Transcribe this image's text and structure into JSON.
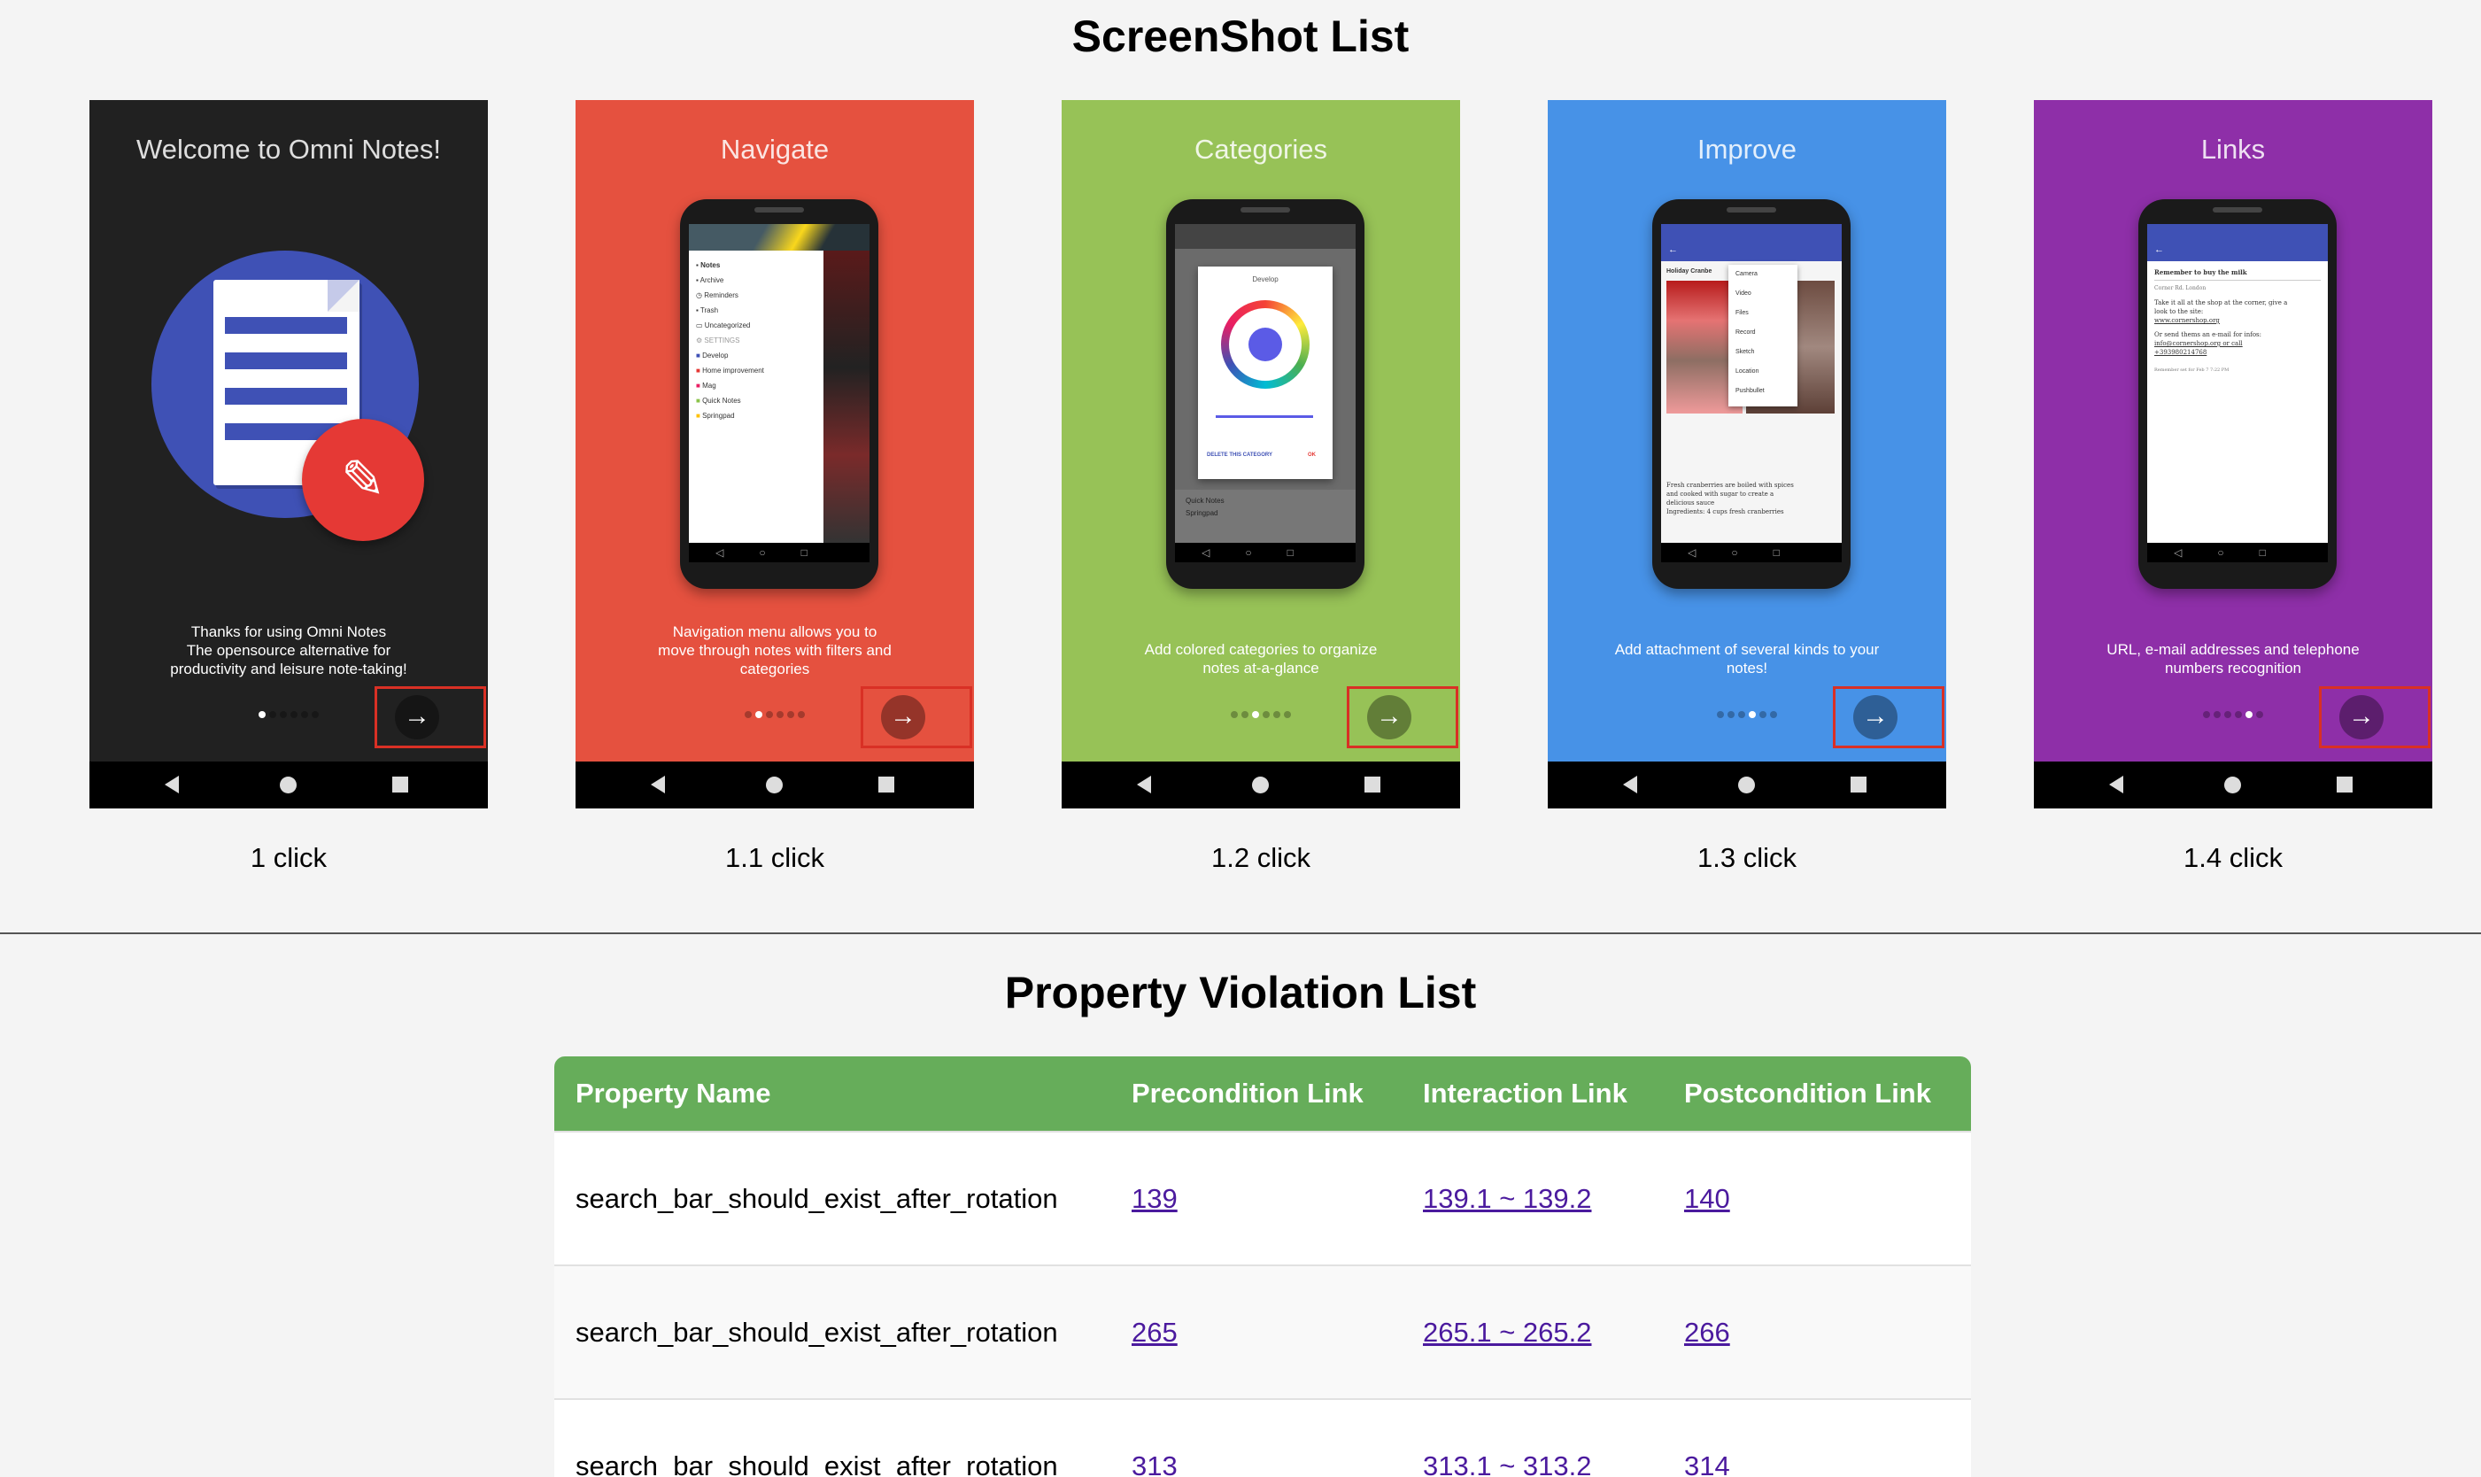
{
  "screenshot_section": {
    "title": "ScreenShot List",
    "shots": [
      {
        "caption": "1 click",
        "screen_title": "Welcome to Omni Notes!",
        "description": [
          "Thanks for using Omni Notes",
          "The opensource alternative for",
          "productivity and leisure note-taking!"
        ],
        "background": "#212121",
        "active_dot": 0
      },
      {
        "caption": "1.1 click",
        "screen_title": "Navigate",
        "description": [
          "Navigation menu allows you to",
          "move through notes with filters and",
          "categories"
        ],
        "background": "#e5513f",
        "active_dot": 1,
        "drawer_items": [
          "Notes",
          "Archive",
          "Reminders",
          "Trash",
          "Uncategorized",
          "SETTINGS",
          "Develop",
          "Home improvement",
          "Mag",
          "Quick Notes",
          "Springpad"
        ]
      },
      {
        "caption": "1.2 click",
        "screen_title": "Categories",
        "description": [
          "Add colored categories to organize",
          "notes at-a-glance"
        ],
        "background": "#97c257",
        "active_dot": 2,
        "dialog": {
          "title": "Develop",
          "delete_label": "DELETE THIS CATEGORY",
          "ok_label": "OK"
        },
        "list_items": [
          "Quick Notes",
          "Springpad"
        ]
      },
      {
        "caption": "1.3 click",
        "screen_title": "Improve",
        "description": [
          "Add attachment of several kinds to your",
          "notes!"
        ],
        "background": "#4792e7",
        "active_dot": 3,
        "menu_items": [
          "Camera",
          "Video",
          "Files",
          "Record",
          "Sketch",
          "Location",
          "Pushbullet"
        ],
        "note_title": "Holiday Cranbe",
        "note_text": [
          "Fresh cranberries are boiled with spices",
          "and cooked with sugar to create a",
          "delicious sauce",
          "Ingredients: 4 cups fresh cranberries"
        ]
      },
      {
        "caption": "1.4 click",
        "screen_title": "Links",
        "description": [
          "URL, e-mail addresses and telephone",
          "numbers recognition"
        ],
        "background": "#8e2fa8",
        "active_dot": 4,
        "note_title": "Remember to buy the milk",
        "note_text": [
          "Corner Rd. London",
          "Take it all at the shop at the corner, give a",
          "look to the site:",
          "www.cornershop.org",
          "Or send thems an e-mail for infos:",
          "info@cornershop.org or call",
          "+393980214768",
          "Remember set for Feb 7 7:22 PM"
        ]
      }
    ]
  },
  "violation_section": {
    "title": "Property Violation List",
    "headers": [
      "Property Name",
      "Precondition Link",
      "Interaction Link",
      "Postcondition Link"
    ],
    "rows": [
      [
        "search_bar_should_exist_after_rotation",
        "139",
        "139.1 ~ 139.2",
        "140"
      ],
      [
        "search_bar_should_exist_after_rotation",
        "265",
        "265.1 ~ 265.2",
        "266"
      ],
      [
        "search_bar_should_exist_after_rotation",
        "313",
        "313.1 ~ 313.2",
        "314"
      ]
    ]
  },
  "colors": {
    "table_header": "#66ad5a",
    "link": "#4b1a9e",
    "highlight_box": "#d93025"
  }
}
